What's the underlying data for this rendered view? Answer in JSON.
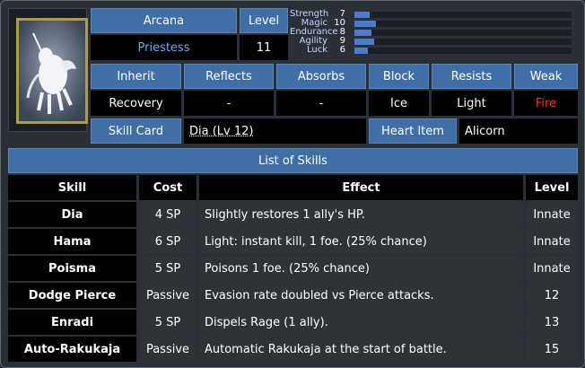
{
  "header": {
    "arcana_label": "Arcana",
    "arcana_value": "Priestess",
    "level_label": "Level",
    "level_value": "11"
  },
  "stats": [
    {
      "label": "Strength",
      "value": "7",
      "fraction": 0.07
    },
    {
      "label": "Magic",
      "value": "10",
      "fraction": 0.1
    },
    {
      "label": "Endurance",
      "value": "8",
      "fraction": 0.08
    },
    {
      "label": "Agility",
      "value": "9",
      "fraction": 0.09
    },
    {
      "label": "Luck",
      "value": "6",
      "fraction": 0.06
    }
  ],
  "affinities": {
    "headers": [
      "Inherit",
      "Reflects",
      "Absorbs",
      "Block",
      "Resists",
      "Weak"
    ],
    "values": [
      "Recovery",
      "-",
      "-",
      "Ice",
      "Light",
      "Fire"
    ]
  },
  "extras": {
    "skill_card_label": "Skill Card",
    "skill_card_value": "Dia (Lv 12)",
    "heart_item_label": "Heart Item",
    "heart_item_value": "Alicorn"
  },
  "skills": {
    "title": "List of Skills",
    "columns": [
      "Skill",
      "Cost",
      "Effect",
      "Level"
    ],
    "rows": [
      {
        "skill": "Dia",
        "cost": "4 SP",
        "effect": "Slightly restores 1 ally's HP.",
        "level": "Innate"
      },
      {
        "skill": "Hama",
        "cost": "6 SP",
        "effect": "Light: instant kill, 1 foe. (25% chance)",
        "level": "Innate"
      },
      {
        "skill": "Poisma",
        "cost": "5 SP",
        "effect": "Poisons 1 foe. (25% chance)",
        "level": "Innate"
      },
      {
        "skill": "Dodge Pierce",
        "cost": "Passive",
        "effect": "Evasion rate doubled vs Pierce attacks.",
        "level": "12"
      },
      {
        "skill": "Enradi",
        "cost": "5 SP",
        "effect": "Dispels Rage (1 ally).",
        "level": "13"
      },
      {
        "skill": "Auto-Rakukaja",
        "cost": "Passive",
        "effect": "Automatic Rakukaja at the start of battle.",
        "level": "15"
      }
    ]
  },
  "colors": {
    "header_blue": "#3f6fa6",
    "weak_red": "#ff3030",
    "arcana_blue": "#6ea6ff"
  }
}
